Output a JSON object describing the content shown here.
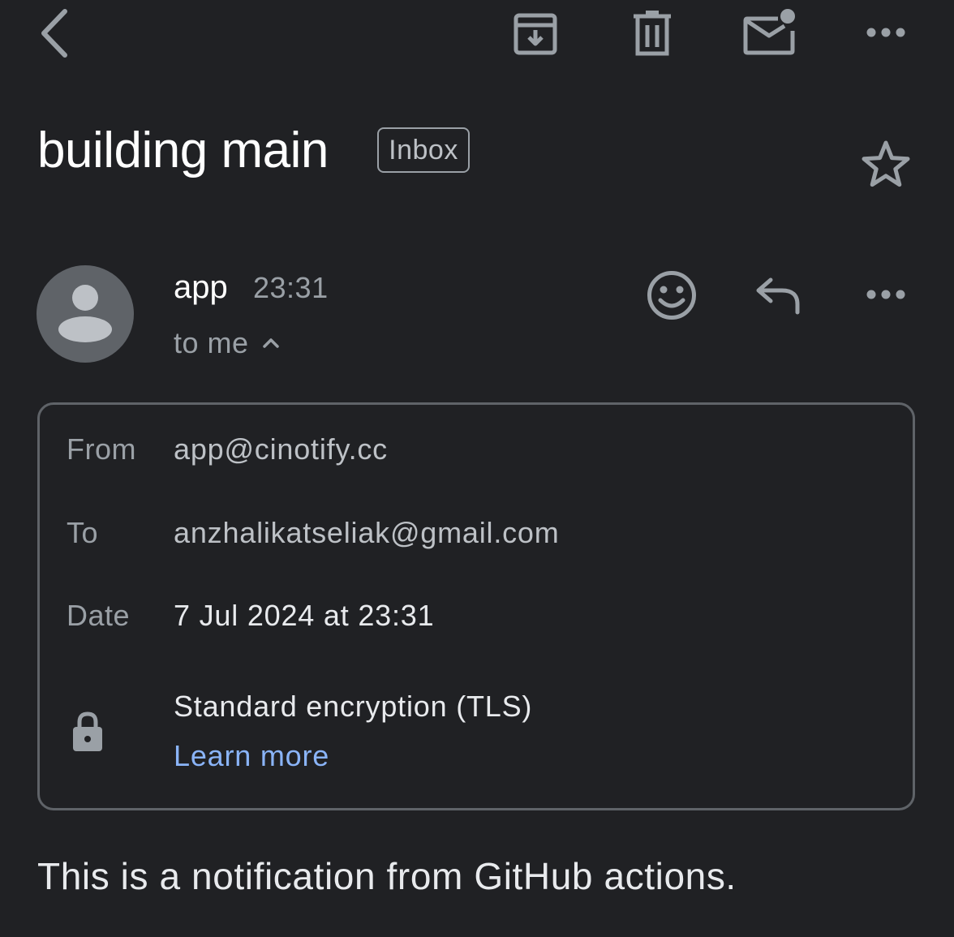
{
  "toolbar": {
    "back": "back-icon",
    "archive": "archive-icon",
    "delete": "delete-icon",
    "mark_unread": "mark-unread-icon",
    "more": "more-icon"
  },
  "email": {
    "subject": "building main",
    "label": "Inbox",
    "sender_name": "app",
    "time": "23:31",
    "recipients_summary": "to me"
  },
  "details": {
    "from_label": "From",
    "from_value": "app@cinotify.cc",
    "to_label": "To",
    "to_value": "anzhalikatseliak@gmail.com",
    "date_label": "Date",
    "date_value": "7 Jul 2024 at 23:31",
    "encryption_text": "Standard encryption (TLS)",
    "learn_more": "Learn more"
  },
  "body": {
    "text": "This is a notification from GitHub actions."
  },
  "colors": {
    "background": "#202124",
    "icon": "#9aa0a6",
    "link": "#8ab4f8",
    "border": "#5f6368"
  }
}
